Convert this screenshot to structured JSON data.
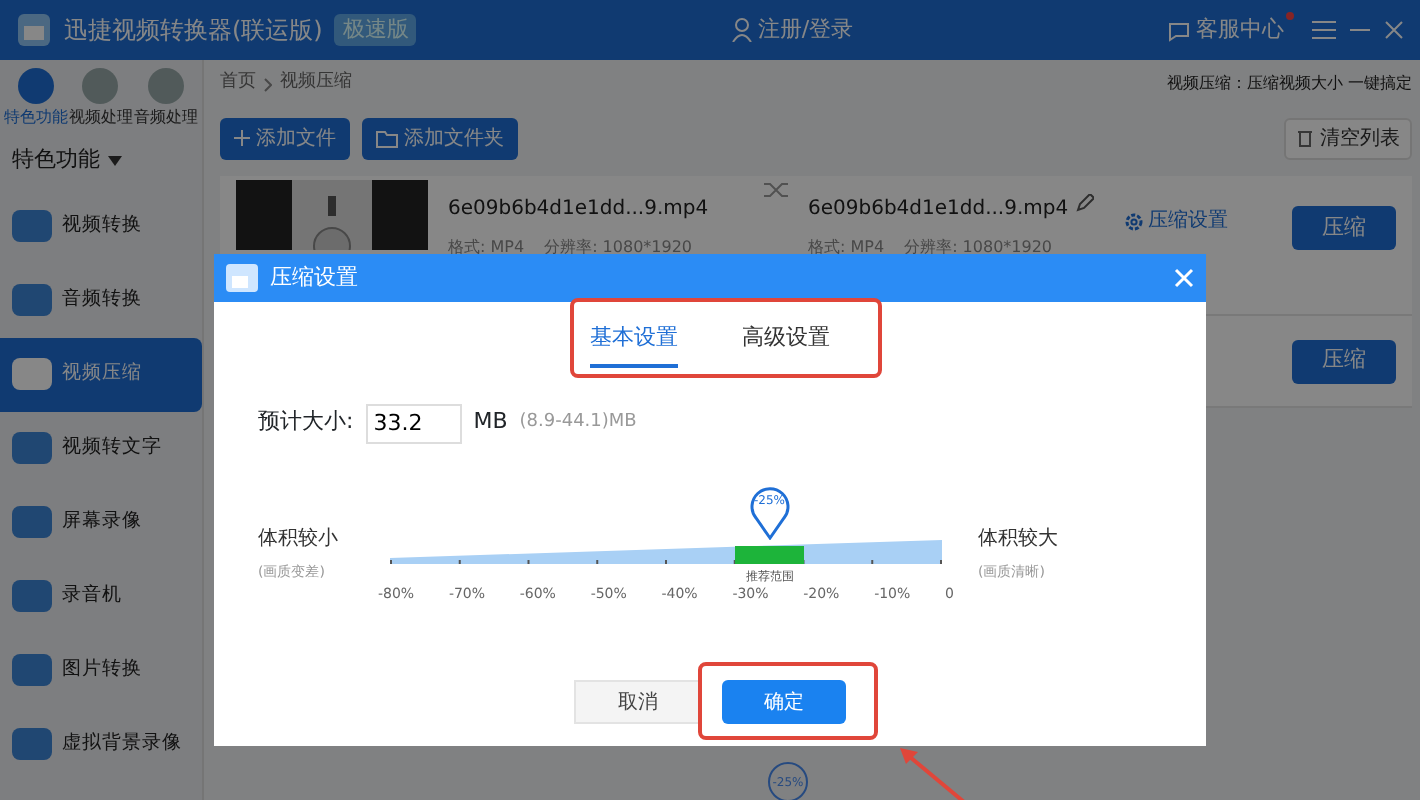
{
  "window": {
    "title": "迅捷视频转换器(联运版)",
    "edition_badge": "极速版"
  },
  "header": {
    "login": "注册/登录",
    "support": "客服中心",
    "support_notification": true
  },
  "category_tabs": [
    {
      "label": "特色功能",
      "selected": true
    },
    {
      "label": "视频处理",
      "selected": false
    },
    {
      "label": "音频处理",
      "selected": false
    }
  ],
  "sidebar": {
    "heading": "特色功能",
    "items": [
      {
        "label": "视频转换",
        "selected": false
      },
      {
        "label": "音频转换",
        "selected": false
      },
      {
        "label": "视频压缩",
        "selected": true
      },
      {
        "label": "视频转文字",
        "selected": false
      },
      {
        "label": "屏幕录像",
        "selected": false
      },
      {
        "label": "录音机",
        "selected": false
      },
      {
        "label": "图片转换",
        "selected": false
      },
      {
        "label": "虚拟背景录像",
        "selected": false
      }
    ]
  },
  "breadcrumb": [
    "首页",
    "视频压缩"
  ],
  "tagline": "视频压缩：压缩视频大小 一键搞定",
  "toolbar": {
    "add_file": "添加文件",
    "add_folder": "添加文件夹",
    "clear": "清空列表"
  },
  "files": [
    {
      "source_name": "6e09b6b4d1e1dd...9.mp4",
      "source_format_label": "格式:",
      "source_format": "MP4",
      "source_resolution_label": "分辨率:",
      "source_resolution": "1080*1920",
      "output_name": "6e09b6b4d1e1dd...9.mp4",
      "output_format_label": "格式:",
      "output_format": "MP4",
      "output_resolution_label": "分辨率:",
      "output_resolution": "1080*1920",
      "settings_link": "压缩设置",
      "action": "压缩"
    },
    {
      "action": "压缩"
    }
  ],
  "dialog": {
    "title": "压缩设置",
    "tabs": [
      {
        "label": "基本设置",
        "selected": true
      },
      {
        "label": "高级设置",
        "selected": false
      }
    ],
    "size_label": "预计大小:",
    "size_value": "33.2",
    "size_unit": "MB",
    "size_range": "(8.9-44.1)MB",
    "slider": {
      "left_label": "体积较小",
      "left_hint": "(画质变差)",
      "right_label": "体积较大",
      "right_hint": "(画质清晰)",
      "ticks": [
        "-80%",
        "-70%",
        "-60%",
        "-50%",
        "-40%",
        "-30%",
        "-20%",
        "-10%",
        "0"
      ],
      "level": 0.6875,
      "pin": "-25%",
      "recommended_label": "推荐范围"
    },
    "cancel": "取消",
    "ok": "确定"
  },
  "background_pin": "-25%"
}
